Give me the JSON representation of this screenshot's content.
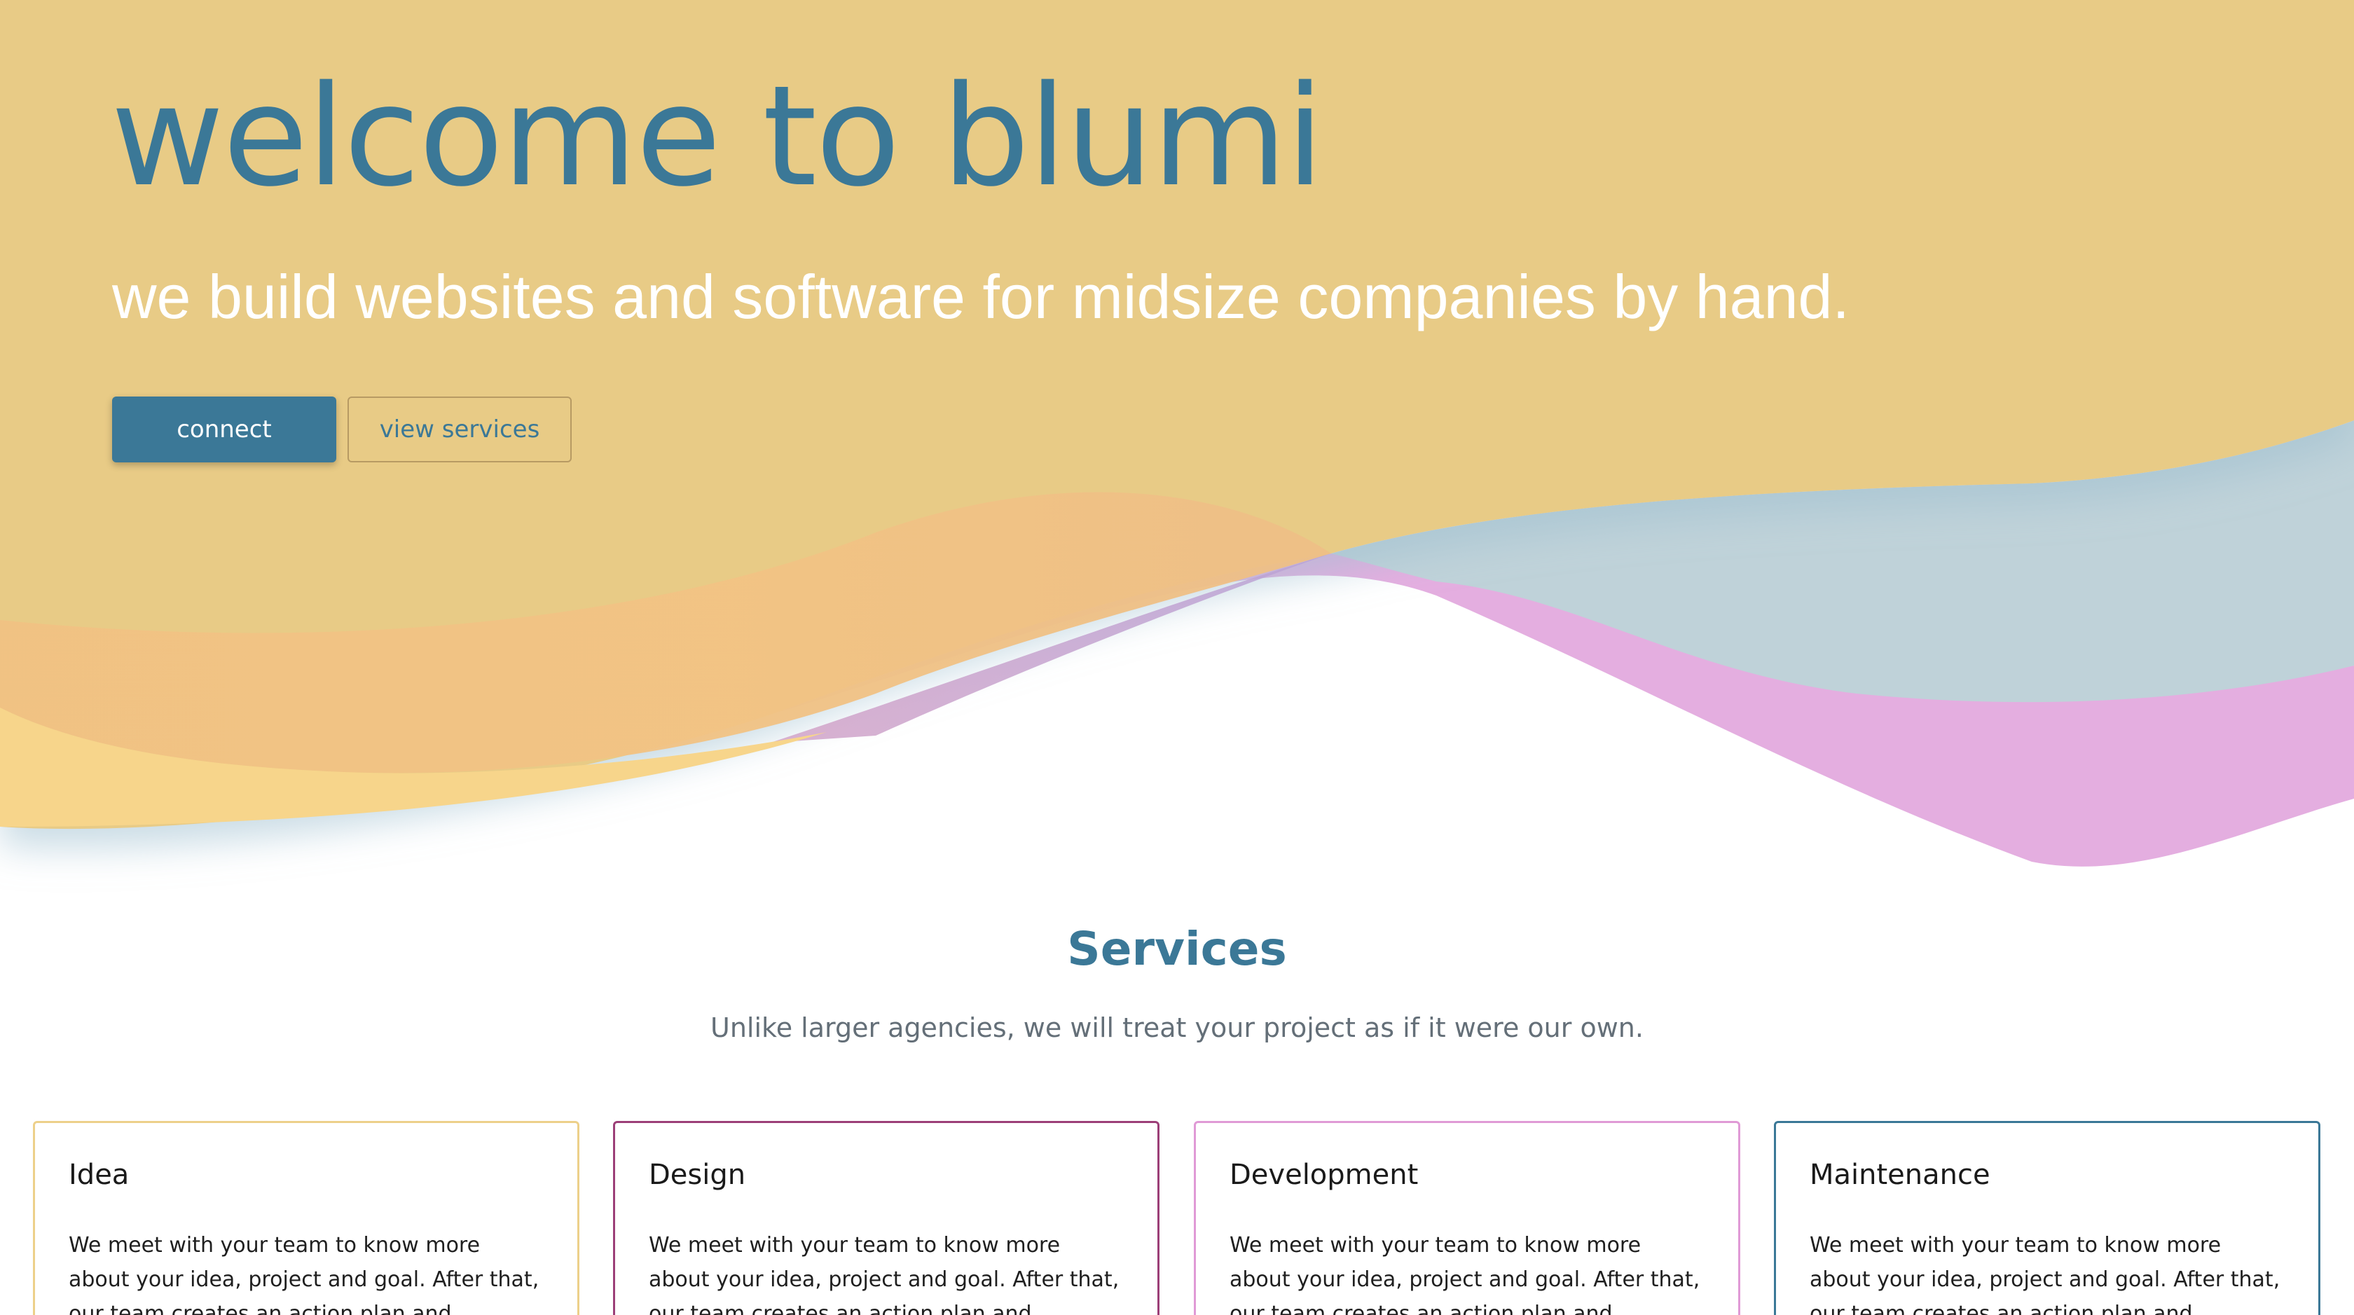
{
  "hero": {
    "title": "welcome to blumi",
    "subtitle": "we build websites and software for midsize companies by hand.",
    "connect_label": "connect",
    "view_services_label": "view services"
  },
  "services": {
    "title": "Services",
    "subtitle": "Unlike larger agencies, we will treat your project as if it were our own.",
    "cards": [
      {
        "title": "Idea",
        "text": "We meet with your team to know more about your idea, project and goal. After that, our team creates an action plan and proposal for your"
      },
      {
        "title": "Design",
        "text": "We meet with your team to know more about your idea, project and goal. After that, our team creates an action plan and proposal for your"
      },
      {
        "title": "Development",
        "text": "We meet with your team to know more about your idea, project and goal. After that, our team creates an action plan and proposal for your"
      },
      {
        "title": "Maintenance",
        "text": "We meet with your team to know more about your idea, project and goal. After that, our team creates an action plan and proposal for your"
      }
    ]
  },
  "colors": {
    "brand_blue": "#3b7897",
    "hero_gold": "#e8cb86",
    "wave_orange": "#f2c384",
    "wave_pink": "#e4aee0",
    "wave_blue": "#bfd2d9"
  }
}
